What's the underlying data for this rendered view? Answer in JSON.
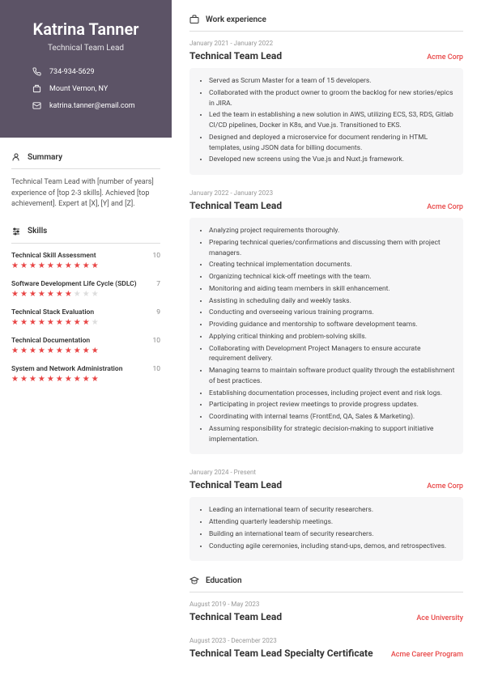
{
  "name": "Katrina Tanner",
  "title": "Technical Team Lead",
  "phone": "734-934-5629",
  "location": "Mount Vernon, NY",
  "email": "katrina.tanner@email.com",
  "sections": {
    "summary": "Summary",
    "skills": "Skills",
    "work": "Work experience",
    "education": "Education"
  },
  "summary": "Technical Team Lead with [number of years] experience of [top 2-3 skills]. Achieved [top achievement]. Expert at [X], [Y] and [Z].",
  "skills": [
    {
      "name": "Technical Skill Assessment",
      "score": 10
    },
    {
      "name": "Software Development Life Cycle (SDLC)",
      "score": 7
    },
    {
      "name": "Technical Stack Evaluation",
      "score": 9
    },
    {
      "name": "Technical Documentation",
      "score": 10
    },
    {
      "name": "System and Network Administration",
      "score": 10
    }
  ],
  "jobs": [
    {
      "dates": "January 2021 - January 2022",
      "title": "Technical Team Lead",
      "company": "Acme Corp",
      "bullets": [
        "Served as Scrum Master for a team of 15 developers.",
        "Collaborated with the product owner to groom the backlog for new stories/epics in JIRA.",
        "Led the team in establishing a new solution in AWS, utilizing ECS, S3, RDS, Gitlab CI/CD pipelines, Docker in K8s, and Vue.js. Transitioned to EKS.",
        "Designed and deployed a microservice for document rendering in HTML templates, using JSON data for billing documents.",
        "Developed new screens using the Vue.js and Nuxt.js framework."
      ]
    },
    {
      "dates": "January 2022 - January 2023",
      "title": "Technical Team Lead",
      "company": "Acme Corp",
      "bullets": [
        "Analyzing project requirements thoroughly.",
        "Preparing technical queries/confirmations and discussing them with project managers.",
        "Creating technical implementation documents.",
        "Organizing technical kick-off meetings with the team.",
        "Monitoring and aiding team members in skill enhancement.",
        "Assisting in scheduling daily and weekly tasks.",
        "Conducting and overseeing various training programs.",
        "Providing guidance and mentorship to software development teams.",
        "Applying critical thinking and problem-solving skills.",
        "Collaborating with Development Project Managers to ensure accurate requirement delivery.",
        "Managing teams to maintain software product quality through the establishment of best practices.",
        "Establishing documentation processes, including project event and risk logs.",
        "Participating in project review meetings to provide progress updates.",
        "Coordinating with internal teams (FrontEnd, QA, Sales & Marketing).",
        "Assuming responsibility for strategic decision-making to support initiative implementation."
      ]
    },
    {
      "dates": "January 2024 - Present",
      "title": "Technical Team Lead",
      "company": "Acme Corp",
      "bullets": [
        "Leading an international team of security researchers.",
        "Attending quarterly leadership meetings.",
        "Building an international team of security researchers.",
        "Conducting agile ceremonies, including stand-ups, demos, and retrospectives."
      ]
    }
  ],
  "education": [
    {
      "dates": "August 2019 - May 2023",
      "title": "Technical Team Lead",
      "org": "Ace University"
    },
    {
      "dates": "August 2023 - December 2023",
      "title": "Technical Team Lead Specialty Certificate",
      "org": "Acme Career Program"
    }
  ]
}
